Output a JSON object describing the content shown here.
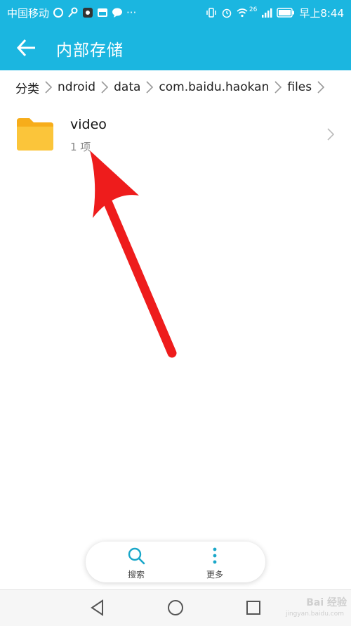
{
  "statusbar": {
    "carrier": "中国移动",
    "signal_label": "26",
    "time": "早上8:44"
  },
  "titlebar": {
    "title": "内部存储"
  },
  "breadcrumb": {
    "items": [
      "分类",
      "ndroid",
      "data",
      "com.baidu.haokan",
      "files"
    ]
  },
  "list": {
    "items": [
      {
        "name": "video",
        "count": "1 项"
      }
    ]
  },
  "bottom_bar": {
    "search_label": "搜索",
    "more_label": "更多"
  },
  "watermark": {
    "text": "Bai 经验",
    "sub": "jingyan.baidu.com"
  },
  "colors": {
    "accent": "#1bb6e0",
    "folder": "#fbbf2d",
    "annotation_arrow": "#ee1c1c"
  }
}
